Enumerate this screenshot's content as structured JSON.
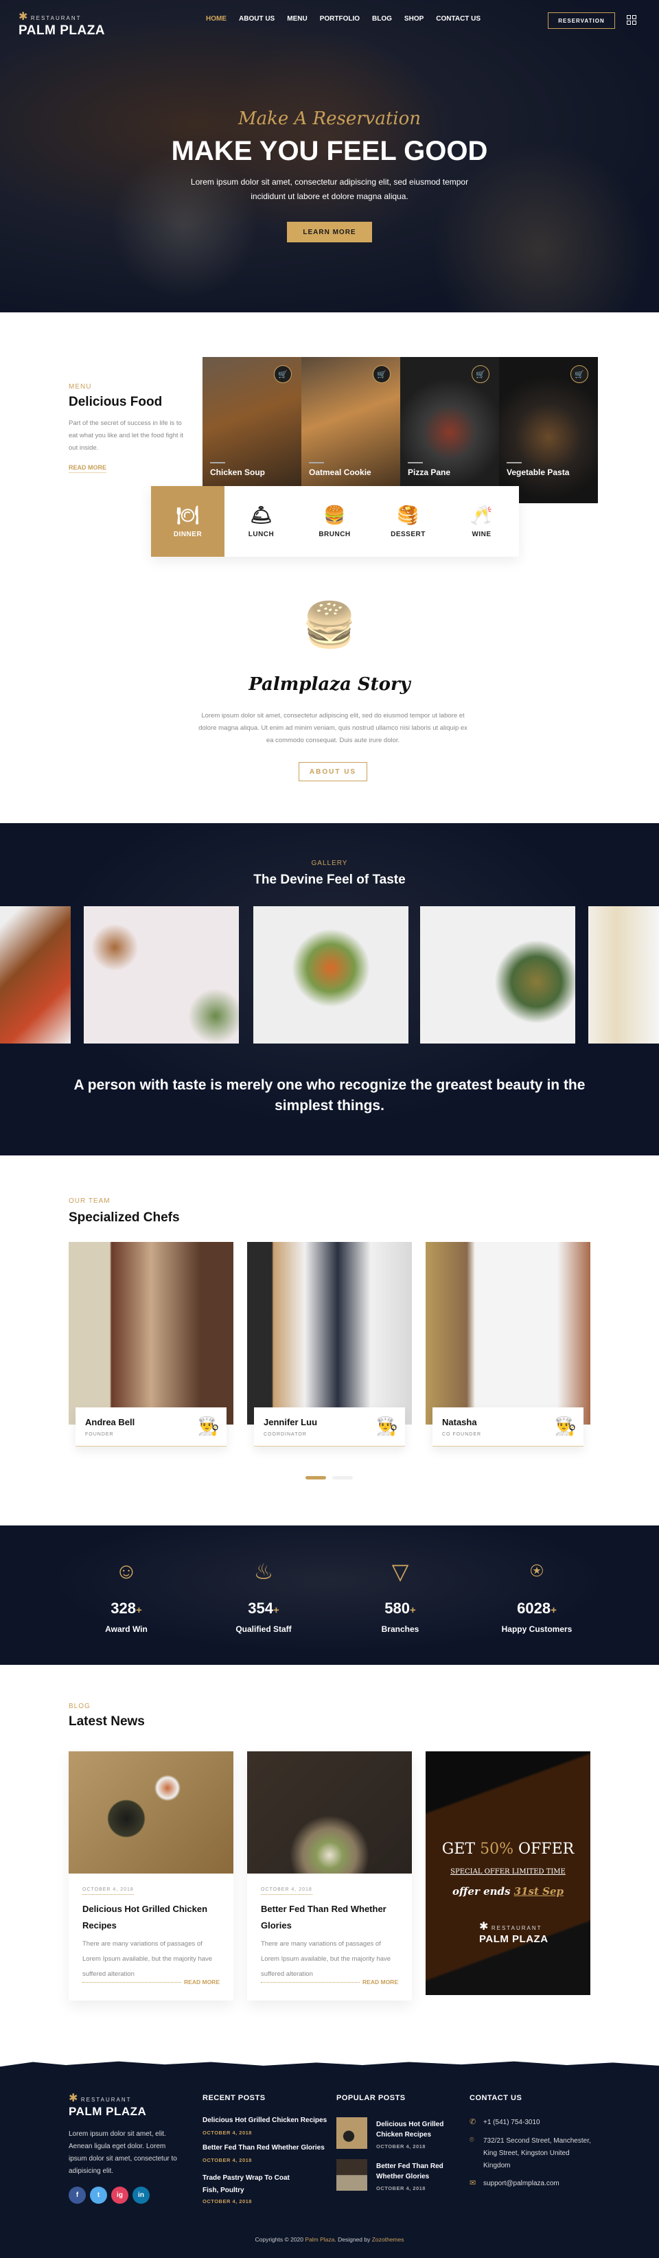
{
  "colors": {
    "gold": "#c9a05a",
    "navy": "#0d1529"
  },
  "header": {
    "logo_small": "RESTAURANT",
    "logo_big": "PALM PLAZA",
    "nav": [
      "HOME",
      "ABOUT US",
      "MENU",
      "PORTFOLIO",
      "BLOG",
      "SHOP",
      "CONTACT US"
    ],
    "reservation": "RESERVATION",
    "menu_icon": "grid-icon"
  },
  "hero": {
    "script": "Make A Reservation",
    "title": "MAKE YOU FEEL GOOD",
    "text1": "Lorem ipsum dolor sit amet, consectetur adipiscing elit, sed eiusmod tempor",
    "text2": "incididunt ut labore et dolore magna aliqua.",
    "button": "LEARN MORE"
  },
  "menu": {
    "label": "MENU",
    "title": "Delicious Food",
    "text": "Part of the secret of success in life is to eat what you like and let the food fight it out inside.",
    "read_more": "READ MORE",
    "items": [
      "Chicken Soup",
      "Oatmeal Cookie",
      "Pizza Pane",
      "Vegetable Pasta"
    ],
    "categories": [
      "DINNER",
      "LUNCH",
      "BRUNCH",
      "DESSERT",
      "WINE"
    ]
  },
  "story": {
    "title": "Palmplaza Story",
    "text": "Lorem ipsum dolor sit amet, consectetur adipiscing elit, sed do eiusmod tempor ut labore et dolore magna aliqua. Ut enim ad minim veniam, quis nostrud ullamco nisi laboris ut aliquip ex ea commodo consequat. Duis aute irure dolor.",
    "button": "ABOUT US"
  },
  "gallery": {
    "label": "GALLERY",
    "title": "The Devine Feel of Taste",
    "quote": "A person with taste is merely one who recognize the greatest beauty in the simplest things."
  },
  "team": {
    "label": "OUR TEAM",
    "title": "Specialized Chefs",
    "chefs": [
      {
        "name": "Andrea Bell",
        "role": "FOUNDER"
      },
      {
        "name": "Jennifer Luu",
        "role": "COORDINATOR"
      },
      {
        "name": "Natasha",
        "role": "CO FOUNDER"
      }
    ],
    "active_slide": 1,
    "slide_count": 2
  },
  "stats": [
    {
      "num": "328",
      "label": "Award Win",
      "icon": "chef-icon"
    },
    {
      "num": "354",
      "label": "Qualified Staff",
      "icon": "food-basket-icon"
    },
    {
      "num": "580",
      "label": "Branches",
      "icon": "pizza-icon"
    },
    {
      "num": "6028",
      "label": "Happy Customers",
      "icon": "plate-icon"
    }
  ],
  "stats_plus": "+",
  "blog": {
    "label": "BLOG",
    "title": "Latest News",
    "posts": [
      {
        "date": "OCTOBER 4, 2018",
        "title": "Delicious Hot Grilled Chicken Recipes",
        "text": "There are many variations of passages of Lorem Ipsum available, but the majority have suffered alteration",
        "more": "READ MORE"
      },
      {
        "date": "OCTOBER 4, 2018",
        "title": "Better Fed Than Red Whether Glories",
        "text": "There are many variations of passages of Lorem Ipsum available, but the majority have suffered alteration",
        "more": "READ MORE"
      }
    ],
    "promo": {
      "get": "GET ",
      "pct": "50%",
      "offer": " OFFER",
      "special": "SPECIAL OFFER LIMITED TIME",
      "ends": "offer ends ",
      "date": "31st Sep",
      "logo_small": "RESTAURANT",
      "logo_big": "PALM PLAZA"
    }
  },
  "footer": {
    "about": "Lorem ipsum dolor sit amet, elit. Aenean ligula eget dolor. Lorem ipsum dolor sit amet, consectetur to adipisicing elit.",
    "social": [
      "f",
      "t",
      "ig",
      "in"
    ],
    "recent_title": "RECENT POSTS",
    "recent": [
      {
        "title": "Delicious Hot Grilled Chicken Recipes",
        "date": "OCTOBER 4, 2018"
      },
      {
        "title": "Better Fed Than Red Whether Glories",
        "date": "OCTOBER 4, 2018"
      },
      {
        "title": "Trade Pastry Wrap To Coat Fish, Poultry",
        "date": "OCTOBER 4, 2018"
      }
    ],
    "popular_title": "POPULAR POSTS",
    "popular": [
      {
        "title": "Delicious Hot Grilled Chicken Recipes",
        "date": "OCTOBER 4, 2018"
      },
      {
        "title": "Better Fed Than Red Whether Glories",
        "date": "OCTOBER 4, 2018"
      }
    ],
    "contact_title": "CONTACT US",
    "phone": "+1 (541) 754-3010",
    "address": "732/21 Second Street, Manchester, King Street, Kingston United Kingdom",
    "email": "support@palmplaza.com",
    "copy1": "Copyrights © 2020 ",
    "copy_brand": "Palm Plaza",
    "copy2": ". Designed by ",
    "copy_designer": "Zozothemes"
  }
}
